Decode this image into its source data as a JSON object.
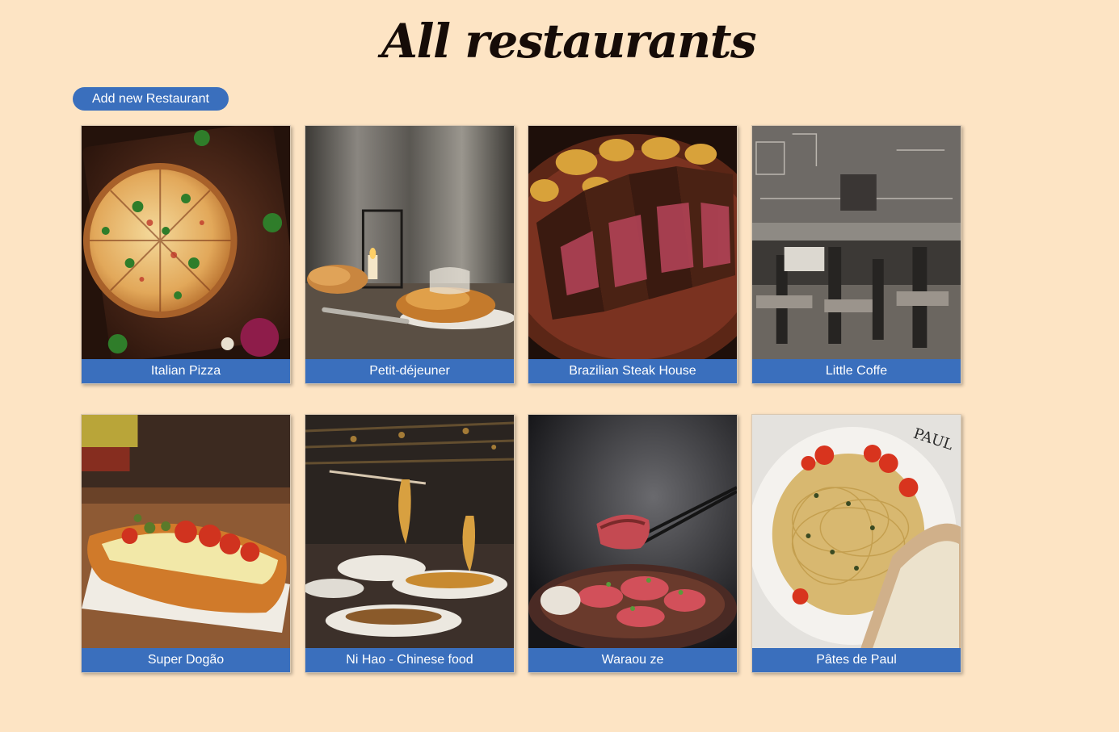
{
  "page": {
    "title": "All restaurants"
  },
  "actions": {
    "add_label": "Add new Restaurant"
  },
  "theme": {
    "background": "#fde4c4",
    "accent": "#3a6fbd",
    "title_color": "#160c08"
  },
  "restaurants": [
    {
      "name": "Italian Pizza",
      "image": "pizza-photo"
    },
    {
      "name": "Petit-déjeuner",
      "image": "croissant-breakfast-photo"
    },
    {
      "name": "Brazilian Steak House",
      "image": "sliced-steak-photo"
    },
    {
      "name": "Little Coffe",
      "image": "coffee-shop-interior-photo"
    },
    {
      "name": "Super Dogão",
      "image": "hot-dog-photo"
    },
    {
      "name": "Ni Hao - Chinese food",
      "image": "noodles-chopsticks-photo"
    },
    {
      "name": "Waraou ze",
      "image": "seared-beef-chopsticks-photo"
    },
    {
      "name": "Pâtes de Paul",
      "image": "spaghetti-bread-photo",
      "logo_text": "PAUL"
    }
  ]
}
